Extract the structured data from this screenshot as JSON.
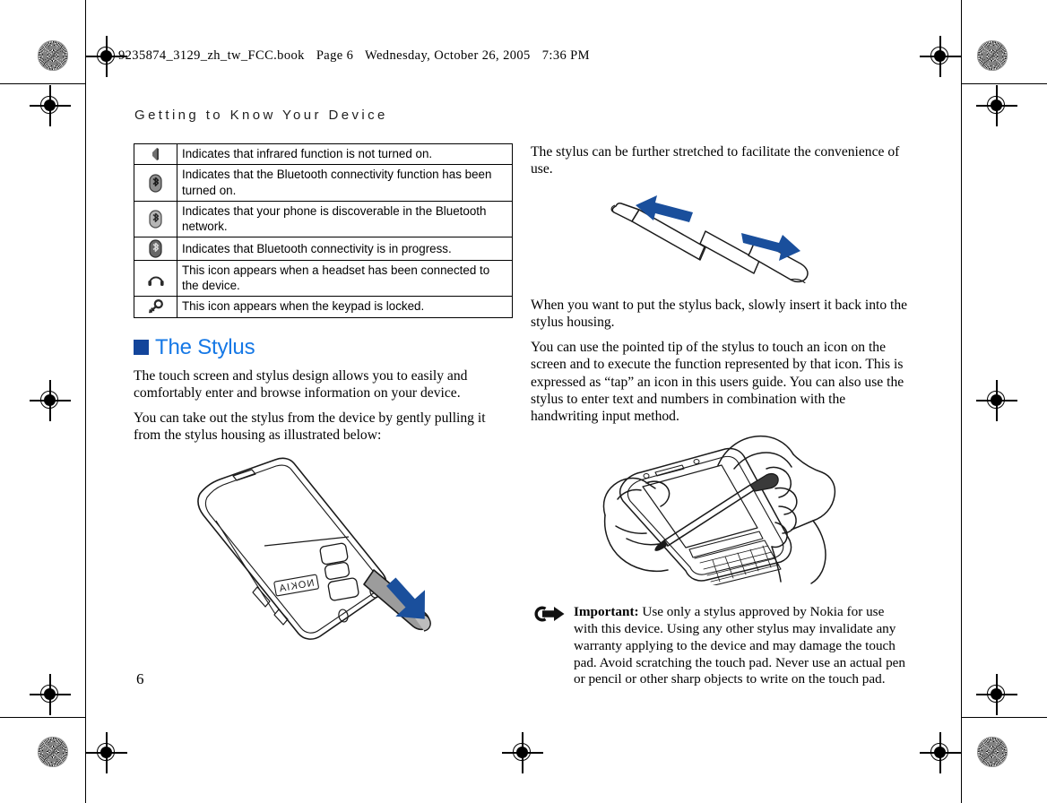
{
  "file_header": {
    "filename": "9235874_3129_zh_tw_FCC.book",
    "page_label": "Page 6",
    "date": "Wednesday, October 26, 2005",
    "time": "7:36 PM"
  },
  "running_head": "Getting to Know Your Device",
  "page_number": "6",
  "icon_table": {
    "rows": [
      {
        "icon": "infrared-off-icon",
        "description": "Indicates that infrared function is not turned on."
      },
      {
        "icon": "bluetooth-on-icon",
        "description": "Indicates that the Bluetooth connectivity function has been turned on."
      },
      {
        "icon": "bluetooth-discoverable-icon",
        "description": "Indicates that your phone is discoverable in the Bluetooth network."
      },
      {
        "icon": "bluetooth-active-icon",
        "description": "Indicates that Bluetooth connectivity is in progress."
      },
      {
        "icon": "headset-icon",
        "description": "This icon appears when a headset has been connected to the device."
      },
      {
        "icon": "key-lock-icon",
        "description": "This icon appears when the keypad is locked."
      }
    ]
  },
  "section": {
    "heading": "The Stylus",
    "paragraphs": [
      "The touch screen and stylus design allows you to easily and comfortably enter and browse information on your device.",
      "You can take out the stylus from the device by gently pulling it from the stylus housing as illustrated below:"
    ]
  },
  "right_column": {
    "paragraph_stretch": "The stylus can be further stretched to facilitate the convenience of use.",
    "paragraph_putback": "When you want to put the stylus back, slowly insert it back into the stylus housing.",
    "paragraph_tap": "You can use the pointed tip of the stylus to touch an icon on the screen and to execute the function represented by that icon. This is expressed as “tap” an icon in this users guide. You can also use the stylus to enter text and numbers in combination with the handwriting input method."
  },
  "important_note": {
    "label": "Important:",
    "text": " Use only a stylus approved by Nokia for use with this device. Using any other stylus may invalidate any warranty applying to the device and may damage the touch pad. Avoid scratching the touch pad. Never use an actual pen or pencil or other sharp objects to write on the touch pad."
  },
  "figures": {
    "device_pullout": "device-stylus-pullout-illustration",
    "stylus_stretch": "stylus-telescoping-illustration",
    "hands_tapping": "hands-holding-device-tapping-illustration"
  },
  "colors": {
    "heading_blue": "#1578e6",
    "bullet_navy": "#13459b",
    "arrow_blue": "#1a4f9c",
    "line_black": "#000000"
  }
}
